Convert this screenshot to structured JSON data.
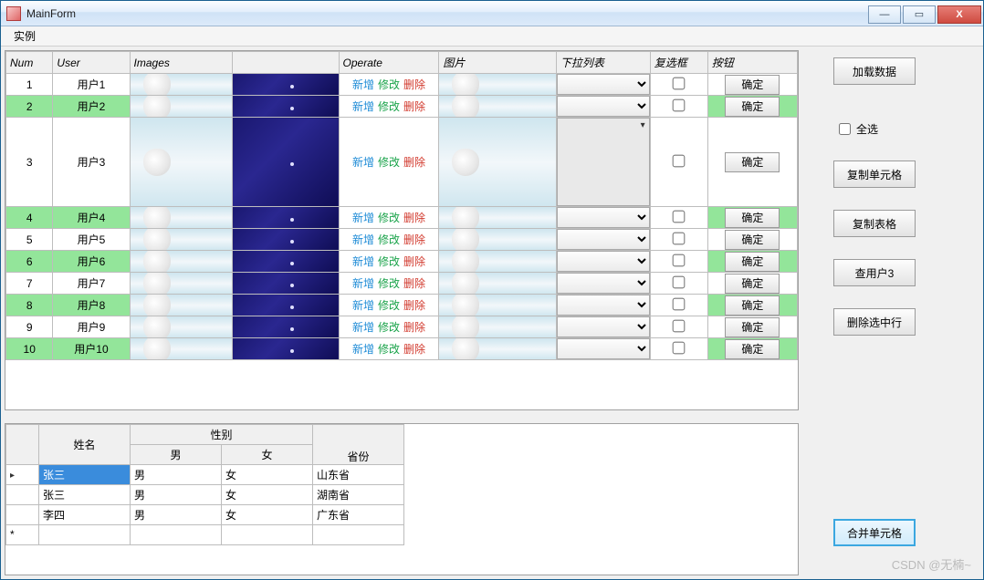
{
  "window": {
    "title": "MainForm",
    "min": "—",
    "max": "▭",
    "close": "X"
  },
  "menu": {
    "item1": "实例"
  },
  "grid1": {
    "headers": {
      "num": "Num",
      "user": "User",
      "images": "Images",
      "operate": "Operate",
      "pic": "图片",
      "dropdown": "下拉列表",
      "check": "复选框",
      "button": "按钮"
    },
    "op": {
      "add": "新增",
      "edit": "修改",
      "del": "删除"
    },
    "btn": "确定",
    "rows": [
      {
        "num": "1",
        "user": "用户1",
        "green": false,
        "tall": false
      },
      {
        "num": "2",
        "user": "用户2",
        "green": true,
        "tall": false
      },
      {
        "num": "3",
        "user": "用户3",
        "green": false,
        "tall": true
      },
      {
        "num": "4",
        "user": "用户4",
        "green": true,
        "tall": false
      },
      {
        "num": "5",
        "user": "用户5",
        "green": false,
        "tall": false
      },
      {
        "num": "6",
        "user": "用户6",
        "green": true,
        "tall": false
      },
      {
        "num": "7",
        "user": "用户7",
        "green": false,
        "tall": false
      },
      {
        "num": "8",
        "user": "用户8",
        "green": true,
        "tall": false
      },
      {
        "num": "9",
        "user": "用户9",
        "green": false,
        "tall": false
      },
      {
        "num": "10",
        "user": "用户10",
        "green": true,
        "tall": false
      }
    ]
  },
  "sidebar": {
    "load": "加载数据",
    "selectall": "全选",
    "copycell": "复制单元格",
    "copytable": "复制表格",
    "finduser3": "查用户3",
    "deleteselected": "删除选中行",
    "mergecell": "合并单元格"
  },
  "grid2": {
    "headers": {
      "name": "姓名",
      "gender": "性别",
      "male": "男",
      "female": "女",
      "province": "省份"
    },
    "rows": [
      {
        "name": "张三",
        "male": "男",
        "female": "女",
        "province": "山东省",
        "selected": true,
        "pointer": true
      },
      {
        "name": "张三",
        "male": "男",
        "female": "女",
        "province": "湖南省",
        "selected": false,
        "pointer": false
      },
      {
        "name": "李四",
        "male": "男",
        "female": "女",
        "province": "广东省",
        "selected": false,
        "pointer": false
      }
    ],
    "newrow_marker": "*"
  },
  "watermark": "CSDN @无楠~"
}
